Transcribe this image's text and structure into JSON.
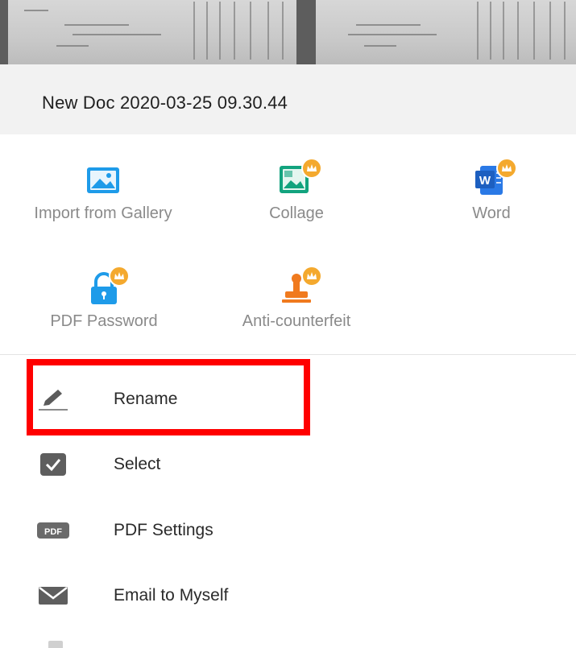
{
  "document": {
    "title": "New Doc 2020-03-25 09.30.44"
  },
  "tools": [
    {
      "label": "Import from Gallery",
      "icon": "image-icon",
      "premium": false
    },
    {
      "label": "Collage",
      "icon": "collage-icon",
      "premium": true
    },
    {
      "label": "Word",
      "icon": "word-icon",
      "premium": true
    },
    {
      "label": "PDF Password",
      "icon": "lock-icon",
      "premium": true
    },
    {
      "label": "Anti-counterfeit",
      "icon": "stamp-icon",
      "premium": true
    }
  ],
  "menu": [
    {
      "label": "Rename",
      "icon": "pencil-icon"
    },
    {
      "label": "Select",
      "icon": "checkbox-icon"
    },
    {
      "label": "PDF Settings",
      "icon": "pdf-icon"
    },
    {
      "label": "Email to Myself",
      "icon": "envelope-icon"
    }
  ],
  "badges": {
    "pdf_badge": "PDF"
  },
  "colors": {
    "accent_blue": "#1e9be9",
    "premium_gold": "#f4a92e",
    "stamp_orange": "#f07a1e",
    "highlight_red": "#ff0000"
  }
}
